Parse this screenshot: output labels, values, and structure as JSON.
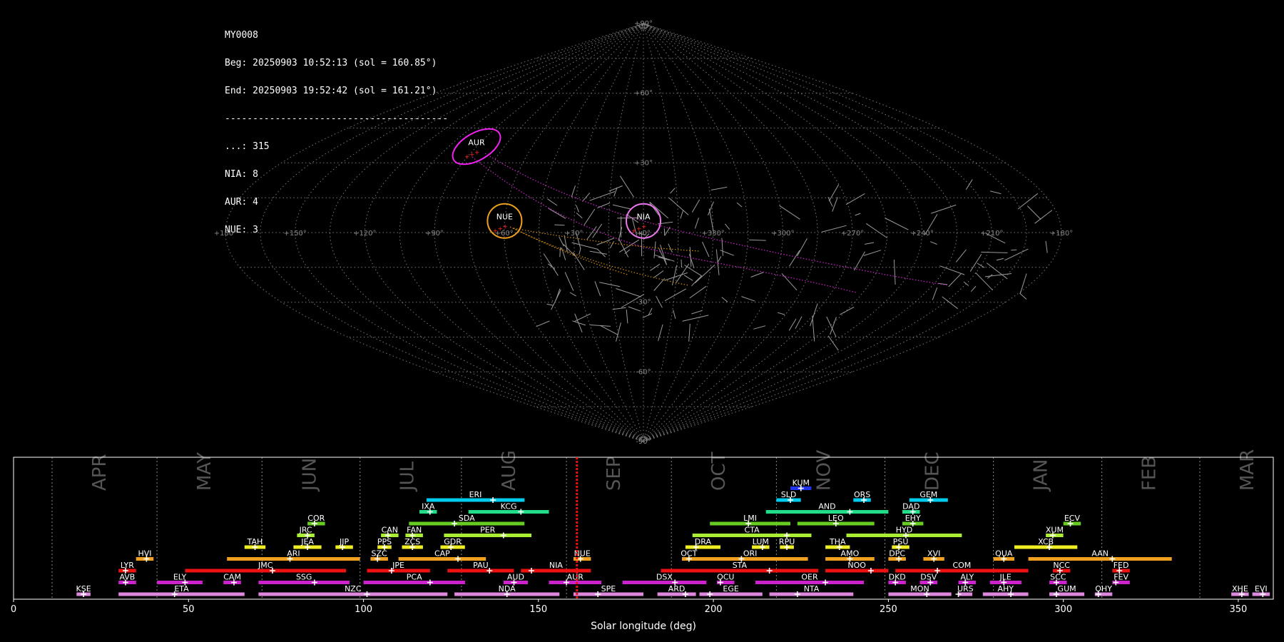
{
  "info": {
    "title": "MY0008",
    "begin": "Beg: 20250903 10:52:13 (sol = 160.85°)",
    "end": "End: 20250903 19:52:42 (sol = 161.21°)",
    "separator": "----------------------------------------",
    "counts": [
      {
        "label": "...",
        "count": 315
      },
      {
        "label": "NIA",
        "count": 8
      },
      {
        "label": "AUR",
        "count": 4
      },
      {
        "label": "NUE",
        "count": 3
      }
    ]
  },
  "sky_map": {
    "projection": "sinusoidal",
    "lon_labels": [
      "+180°",
      "+150°",
      "+120°",
      "+90°",
      "+60°",
      "+30°",
      "+0°",
      "+330°",
      "+300°",
      "+270°",
      "+240°",
      "+210°",
      "+180°"
    ],
    "lat_labels": {
      "90": "+90°",
      "60": "+60°",
      "30": "+30°",
      "-30": "-30°",
      "-60": "-60°",
      "-90": "-90°"
    },
    "radiants": [
      {
        "code": "AUR",
        "lon": 90,
        "lat": 37,
        "color": "#ee22ee",
        "shape": "ellipse"
      },
      {
        "code": "NUE",
        "lon": 60,
        "lat": 5,
        "color": "#f0a020",
        "shape": "circle"
      },
      {
        "code": "NIA",
        "lon": 0,
        "lat": 5,
        "color": "#ee77ee",
        "shape": "circle"
      }
    ]
  },
  "timeline": {
    "xlabel": "Solar longitude (deg)",
    "xlim": [
      0,
      360
    ],
    "ticks": [
      0,
      50,
      100,
      150,
      200,
      250,
      300,
      350
    ],
    "current_sol": 161.0,
    "months": [
      {
        "name": "APR",
        "start": 11
      },
      {
        "name": "MAY",
        "start": 41
      },
      {
        "name": "JUN",
        "start": 71
      },
      {
        "name": "JUL",
        "start": 99
      },
      {
        "name": "AUG",
        "start": 128
      },
      {
        "name": "SEP",
        "start": 158
      },
      {
        "name": "OCT",
        "start": 188
      },
      {
        "name": "NOV",
        "start": 218
      },
      {
        "name": "DEC",
        "start": 249
      },
      {
        "name": "JAN",
        "start": 280
      },
      {
        "name": "FEB",
        "start": 311
      },
      {
        "name": "MAR",
        "start": 339
      }
    ]
  },
  "chart_data": {
    "type": "timeline",
    "showers": [
      {
        "code": "KUM",
        "start": 222,
        "end": 228,
        "peak": 225,
        "row": 9,
        "color": "#2233ee"
      },
      {
        "code": "ERI",
        "start": 118,
        "end": 146,
        "peak": 137,
        "row": 8,
        "color": "#00ccee"
      },
      {
        "code": "SLD",
        "start": 218,
        "end": 225,
        "peak": 222,
        "row": 8,
        "color": "#00ccee"
      },
      {
        "code": "ORS",
        "start": 240,
        "end": 245,
        "peak": 243,
        "row": 8,
        "color": "#00ccee"
      },
      {
        "code": "GEM",
        "start": 256,
        "end": 267,
        "peak": 262,
        "row": 8,
        "color": "#00ccee"
      },
      {
        "code": "IXA",
        "start": 116,
        "end": 121,
        "peak": 119,
        "row": 7,
        "color": "#22dd88"
      },
      {
        "code": "KCG",
        "start": 130,
        "end": 153,
        "peak": 145,
        "row": 7,
        "color": "#22dd88"
      },
      {
        "code": "AND",
        "start": 215,
        "end": 250,
        "peak": 239,
        "row": 7,
        "color": "#22dd88"
      },
      {
        "code": "DAD",
        "start": 254,
        "end": 259,
        "peak": 257,
        "row": 7,
        "color": "#22dd88"
      },
      {
        "code": "COR",
        "start": 84,
        "end": 89,
        "peak": 86,
        "row": 6,
        "color": "#66cc22"
      },
      {
        "code": "SDA",
        "start": 113,
        "end": 146,
        "peak": 126,
        "row": 6,
        "color": "#66cc22"
      },
      {
        "code": "LMI",
        "start": 199,
        "end": 222,
        "peak": 210,
        "row": 6,
        "color": "#66cc22"
      },
      {
        "code": "LEO",
        "start": 224,
        "end": 246,
        "peak": 235,
        "row": 6,
        "color": "#66cc22"
      },
      {
        "code": "EHY",
        "start": 254,
        "end": 260,
        "peak": 257,
        "row": 6,
        "color": "#66cc22"
      },
      {
        "code": "ECV",
        "start": 300,
        "end": 305,
        "peak": 302,
        "row": 6,
        "color": "#66cc22"
      },
      {
        "code": "JRC",
        "start": 81,
        "end": 86,
        "peak": 84,
        "row": 5,
        "color": "#aaee33"
      },
      {
        "code": "CAN",
        "start": 105,
        "end": 110,
        "peak": 107,
        "row": 5,
        "color": "#aaee33"
      },
      {
        "code": "FAN",
        "start": 112,
        "end": 117,
        "peak": 114,
        "row": 5,
        "color": "#aaee33"
      },
      {
        "code": "PER",
        "start": 123,
        "end": 148,
        "peak": 140,
        "row": 5,
        "color": "#aaee33"
      },
      {
        "code": "CTA",
        "start": 194,
        "end": 228,
        "peak": 221,
        "row": 5,
        "color": "#aaee33"
      },
      {
        "code": "HYD",
        "start": 238,
        "end": 271,
        "peak": 255,
        "row": 5,
        "color": "#aaee33"
      },
      {
        "code": "XUM",
        "start": 295,
        "end": 300,
        "peak": 297,
        "row": 5,
        "color": "#aaee33"
      },
      {
        "code": "TAH",
        "start": 66,
        "end": 72,
        "peak": 69,
        "row": 4,
        "color": "#eeee22"
      },
      {
        "code": "JEA",
        "start": 80,
        "end": 88,
        "peak": 84,
        "row": 4,
        "color": "#eeee22"
      },
      {
        "code": "JIP",
        "start": 92,
        "end": 97,
        "peak": 94,
        "row": 4,
        "color": "#eeee22"
      },
      {
        "code": "PPS",
        "start": 104,
        "end": 108,
        "peak": 106,
        "row": 4,
        "color": "#eeee22"
      },
      {
        "code": "ZCS",
        "start": 111,
        "end": 117,
        "peak": 114,
        "row": 4,
        "color": "#eeee22"
      },
      {
        "code": "GDR",
        "start": 122,
        "end": 129,
        "peak": 125,
        "row": 4,
        "color": "#eeee22"
      },
      {
        "code": "DRA",
        "start": 192,
        "end": 202,
        "peak": 195,
        "row": 4,
        "color": "#eeee22"
      },
      {
        "code": "LUM",
        "start": 211,
        "end": 216,
        "peak": 214,
        "row": 4,
        "color": "#eeee22"
      },
      {
        "code": "RPU",
        "start": 219,
        "end": 223,
        "peak": 221,
        "row": 4,
        "color": "#eeee22"
      },
      {
        "code": "THA",
        "start": 232,
        "end": 239,
        "peak": 236,
        "row": 4,
        "color": "#eeee22"
      },
      {
        "code": "PSU",
        "start": 251,
        "end": 256,
        "peak": 253,
        "row": 4,
        "color": "#eeee22"
      },
      {
        "code": "XCB",
        "start": 286,
        "end": 304,
        "peak": 296,
        "row": 4,
        "color": "#eeee22"
      },
      {
        "code": "HVI",
        "start": 35,
        "end": 40,
        "peak": 38,
        "row": 3,
        "color": "#f0a020"
      },
      {
        "code": "ARI",
        "start": 61,
        "end": 99,
        "peak": 79,
        "row": 3,
        "color": "#f0a020"
      },
      {
        "code": "SZC",
        "start": 102,
        "end": 107,
        "peak": 104,
        "row": 3,
        "color": "#f0a020"
      },
      {
        "code": "CAP",
        "start": 110,
        "end": 135,
        "peak": 127,
        "row": 3,
        "color": "#f0a020"
      },
      {
        "code": "NUE",
        "start": 160,
        "end": 165,
        "peak": 162,
        "row": 3,
        "color": "#f0a020"
      },
      {
        "code": "OCT",
        "start": 191,
        "end": 195,
        "peak": 193,
        "row": 3,
        "color": "#f0a020"
      },
      {
        "code": "ORI",
        "start": 194,
        "end": 227,
        "peak": 208,
        "row": 3,
        "color": "#f0a020"
      },
      {
        "code": "AMO",
        "start": 232,
        "end": 246,
        "peak": 239,
        "row": 3,
        "color": "#f0a020"
      },
      {
        "code": "DPC",
        "start": 250,
        "end": 255,
        "peak": 253,
        "row": 3,
        "color": "#f0a020"
      },
      {
        "code": "XVI",
        "start": 260,
        "end": 266,
        "peak": 263,
        "row": 3,
        "color": "#f0a020"
      },
      {
        "code": "QUA",
        "start": 280,
        "end": 286,
        "peak": 283,
        "row": 3,
        "color": "#f0a020"
      },
      {
        "code": "AAN",
        "start": 290,
        "end": 331,
        "peak": 314,
        "row": 3,
        "color": "#f0a020"
      },
      {
        "code": "LYR",
        "start": 30,
        "end": 35,
        "peak": 32,
        "row": 2,
        "color": "#ee1111"
      },
      {
        "code": "JMC",
        "start": 49,
        "end": 95,
        "peak": 74,
        "row": 2,
        "color": "#ee1111"
      },
      {
        "code": "JPE",
        "start": 101,
        "end": 119,
        "peak": 108,
        "row": 2,
        "color": "#ee1111"
      },
      {
        "code": "PAU",
        "start": 124,
        "end": 143,
        "peak": 136,
        "row": 2,
        "color": "#ee1111"
      },
      {
        "code": "NIA",
        "start": 145,
        "end": 165,
        "peak": 148,
        "row": 2,
        "color": "#ee1111"
      },
      {
        "code": "STA",
        "start": 185,
        "end": 230,
        "peak": 216,
        "row": 2,
        "color": "#ee1111"
      },
      {
        "code": "NOO",
        "start": 232,
        "end": 250,
        "peak": 245,
        "row": 2,
        "color": "#ee1111"
      },
      {
        "code": "COM",
        "start": 252,
        "end": 290,
        "peak": 264,
        "row": 2,
        "color": "#ee1111"
      },
      {
        "code": "NCC",
        "start": 297,
        "end": 302,
        "peak": 299,
        "row": 2,
        "color": "#ee1111"
      },
      {
        "code": "FED",
        "start": 314,
        "end": 319,
        "peak": 316,
        "row": 2,
        "color": "#ee1111"
      },
      {
        "code": "AVB",
        "start": 30,
        "end": 35,
        "peak": 32,
        "row": 1,
        "color": "#cc22cc"
      },
      {
        "code": "ELY",
        "start": 41,
        "end": 54,
        "peak": 49,
        "row": 1,
        "color": "#cc22cc"
      },
      {
        "code": "CAM",
        "start": 60,
        "end": 65,
        "peak": 63,
        "row": 1,
        "color": "#cc22cc"
      },
      {
        "code": "SSG",
        "start": 70,
        "end": 96,
        "peak": 86,
        "row": 1,
        "color": "#cc22cc"
      },
      {
        "code": "PCA",
        "start": 100,
        "end": 129,
        "peak": 119,
        "row": 1,
        "color": "#cc22cc"
      },
      {
        "code": "AUD",
        "start": 140,
        "end": 147,
        "peak": 143,
        "row": 1,
        "color": "#cc22cc"
      },
      {
        "code": "AUR",
        "start": 153,
        "end": 168,
        "peak": 158,
        "row": 1,
        "color": "#cc22cc"
      },
      {
        "code": "DSX",
        "start": 174,
        "end": 198,
        "peak": 189,
        "row": 1,
        "color": "#cc22cc"
      },
      {
        "code": "OCU",
        "start": 201,
        "end": 206,
        "peak": 202,
        "row": 1,
        "color": "#cc22cc"
      },
      {
        "code": "OER",
        "start": 212,
        "end": 243,
        "peak": 232,
        "row": 1,
        "color": "#cc22cc"
      },
      {
        "code": "DKD",
        "start": 250,
        "end": 255,
        "peak": 252,
        "row": 1,
        "color": "#cc22cc"
      },
      {
        "code": "DSV",
        "start": 259,
        "end": 264,
        "peak": 262,
        "row": 1,
        "color": "#cc22cc"
      },
      {
        "code": "ALY",
        "start": 270,
        "end": 275,
        "peak": 272,
        "row": 1,
        "color": "#cc22cc"
      },
      {
        "code": "JLE",
        "start": 279,
        "end": 288,
        "peak": 283,
        "row": 1,
        "color": "#cc22cc"
      },
      {
        "code": "SCC",
        "start": 296,
        "end": 301,
        "peak": 298,
        "row": 1,
        "color": "#cc22cc"
      },
      {
        "code": "FEV",
        "start": 314,
        "end": 319,
        "peak": 315,
        "row": 1,
        "color": "#cc22cc"
      },
      {
        "code": "KSE",
        "start": 18,
        "end": 22,
        "peak": 20,
        "row": 0,
        "color": "#dd88dd"
      },
      {
        "code": "ETA",
        "start": 30,
        "end": 66,
        "peak": 46,
        "row": 0,
        "color": "#dd88dd"
      },
      {
        "code": "NZC",
        "start": 70,
        "end": 124,
        "peak": 101,
        "row": 0,
        "color": "#dd88dd"
      },
      {
        "code": "NDA",
        "start": 126,
        "end": 156,
        "peak": 141,
        "row": 0,
        "color": "#dd88dd"
      },
      {
        "code": "SPE",
        "start": 160,
        "end": 180,
        "peak": 167,
        "row": 0,
        "color": "#dd88dd"
      },
      {
        "code": "ARD",
        "start": 184,
        "end": 195,
        "peak": 192,
        "row": 0,
        "color": "#dd88dd"
      },
      {
        "code": "EGE",
        "start": 196,
        "end": 214,
        "peak": 199,
        "row": 0,
        "color": "#dd88dd"
      },
      {
        "code": "NTA",
        "start": 216,
        "end": 240,
        "peak": 224,
        "row": 0,
        "color": "#dd88dd"
      },
      {
        "code": "MON",
        "start": 250,
        "end": 268,
        "peak": 261,
        "row": 0,
        "color": "#dd88dd"
      },
      {
        "code": "URS",
        "start": 270,
        "end": 274,
        "peak": 270,
        "row": 0,
        "color": "#dd88dd"
      },
      {
        "code": "AHY",
        "start": 277,
        "end": 290,
        "peak": 285,
        "row": 0,
        "color": "#dd88dd"
      },
      {
        "code": "GUM",
        "start": 296,
        "end": 306,
        "peak": 298,
        "row": 0,
        "color": "#dd88dd"
      },
      {
        "code": "OHY",
        "start": 309,
        "end": 314,
        "peak": 310,
        "row": 0,
        "color": "#dd88dd"
      },
      {
        "code": "XHE",
        "start": 348,
        "end": 353,
        "peak": 351,
        "row": 0,
        "color": "#dd88dd"
      },
      {
        "code": "EVI",
        "start": 354,
        "end": 359,
        "peak": 357,
        "row": 0,
        "color": "#dd88dd"
      }
    ]
  }
}
